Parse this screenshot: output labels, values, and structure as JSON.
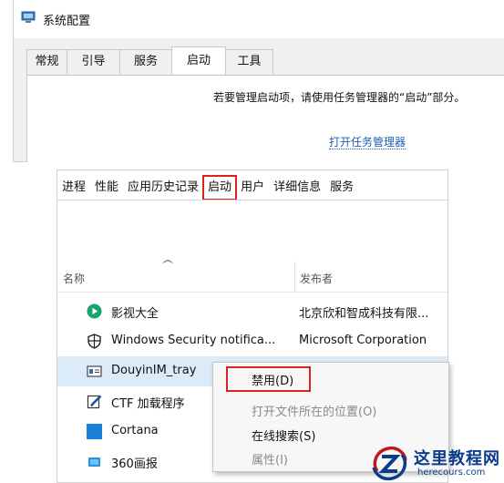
{
  "msconfig": {
    "title": "系统配置",
    "tabs": [
      "常规",
      "引导",
      "服务",
      "启动",
      "工具"
    ],
    "active_tab": "启动",
    "message": "若要管理启动项，请使用任务管理器的“启动”部分。",
    "link": "打开任务管理器"
  },
  "taskmgr": {
    "tabs": [
      "进程",
      "性能",
      "应用历史记录",
      "启动",
      "用户",
      "详细信息",
      "服务"
    ],
    "active_tab": "启动",
    "columns": {
      "name": "名称",
      "publisher": "发布者"
    },
    "rows": [
      {
        "name": "影视大全",
        "publisher": "北京欣和智成科技有限...",
        "icon": "play-circle-icon"
      },
      {
        "name": "Windows Security notifica...",
        "publisher": "Microsoft Corporation",
        "icon": "shield-icon"
      },
      {
        "name": "DouyinIM_tray",
        "publisher": "",
        "icon": "window-app-icon",
        "selected": true
      },
      {
        "name": "CTF 加载程序",
        "publisher": "",
        "icon": "pen-edit-icon"
      },
      {
        "name": "Cortana",
        "publisher": "",
        "icon": "cortana-icon"
      },
      {
        "name": "360画报",
        "publisher": "",
        "icon": "picture-icon"
      }
    ]
  },
  "context_menu": {
    "items": [
      {
        "label": "禁用(D)",
        "enabled": true
      },
      {
        "label": "打开文件所在的位置(O)",
        "enabled": false
      },
      {
        "label": "在线搜索(S)",
        "enabled": true
      },
      {
        "label": "属性(I)",
        "enabled": false
      }
    ]
  },
  "watermark": {
    "name": "这里教程网",
    "url": "herecours.com"
  },
  "colors": {
    "highlight_red": "#e0201c",
    "link_blue": "#1a5fb4",
    "selected_row": "#dcebf8",
    "watermark_blue": "#0b3c8c"
  }
}
